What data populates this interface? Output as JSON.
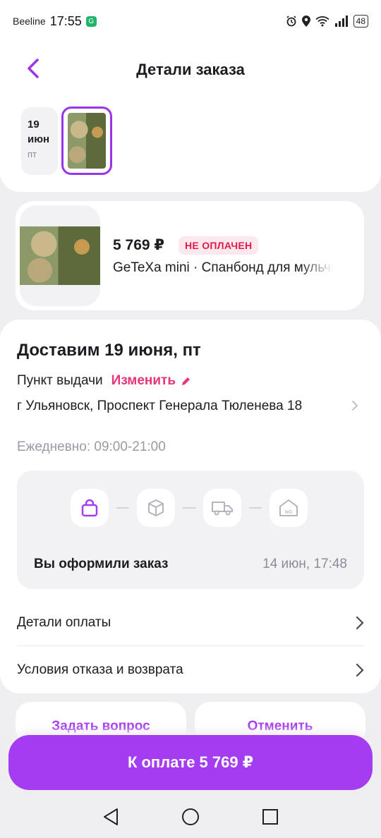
{
  "status_bar": {
    "carrier": "Beeline",
    "time": "17:55",
    "battery": "48"
  },
  "header": {
    "title": "Детали заказа",
    "date_chip": {
      "day": "19",
      "month": "июн",
      "weekday": "пт"
    }
  },
  "product": {
    "price": "5 769 ₽",
    "status": "НЕ ОПЛАЧЕН",
    "name": "GeTeXa mini · Спанбонд для мульчирования"
  },
  "delivery": {
    "title": "Доставим 19 июня, пт",
    "pickup_label": "Пункт выдачи",
    "change_label": "Изменить",
    "address": "г Ульяновск, Проспект Генерала Тюленева 18",
    "hours": "Ежедневно: 09:00-21:00",
    "tracking": {
      "status": "Вы оформили заказ",
      "time": "14 июн, 17:48",
      "step_icons": [
        "bag-icon",
        "box-icon",
        "truck-icon",
        "wb-pickup-icon"
      ]
    }
  },
  "menu": {
    "payment_details": "Детали оплаты",
    "return_terms": "Условия отказа и возврата"
  },
  "actions": {
    "ask_question": "Задать вопрос",
    "cancel": "Отменить",
    "pay_label": "К оплате 5 769 ₽"
  },
  "colors": {
    "accent": "#a43df2",
    "badge_text": "#e3194b",
    "change_link": "#e6357a"
  }
}
